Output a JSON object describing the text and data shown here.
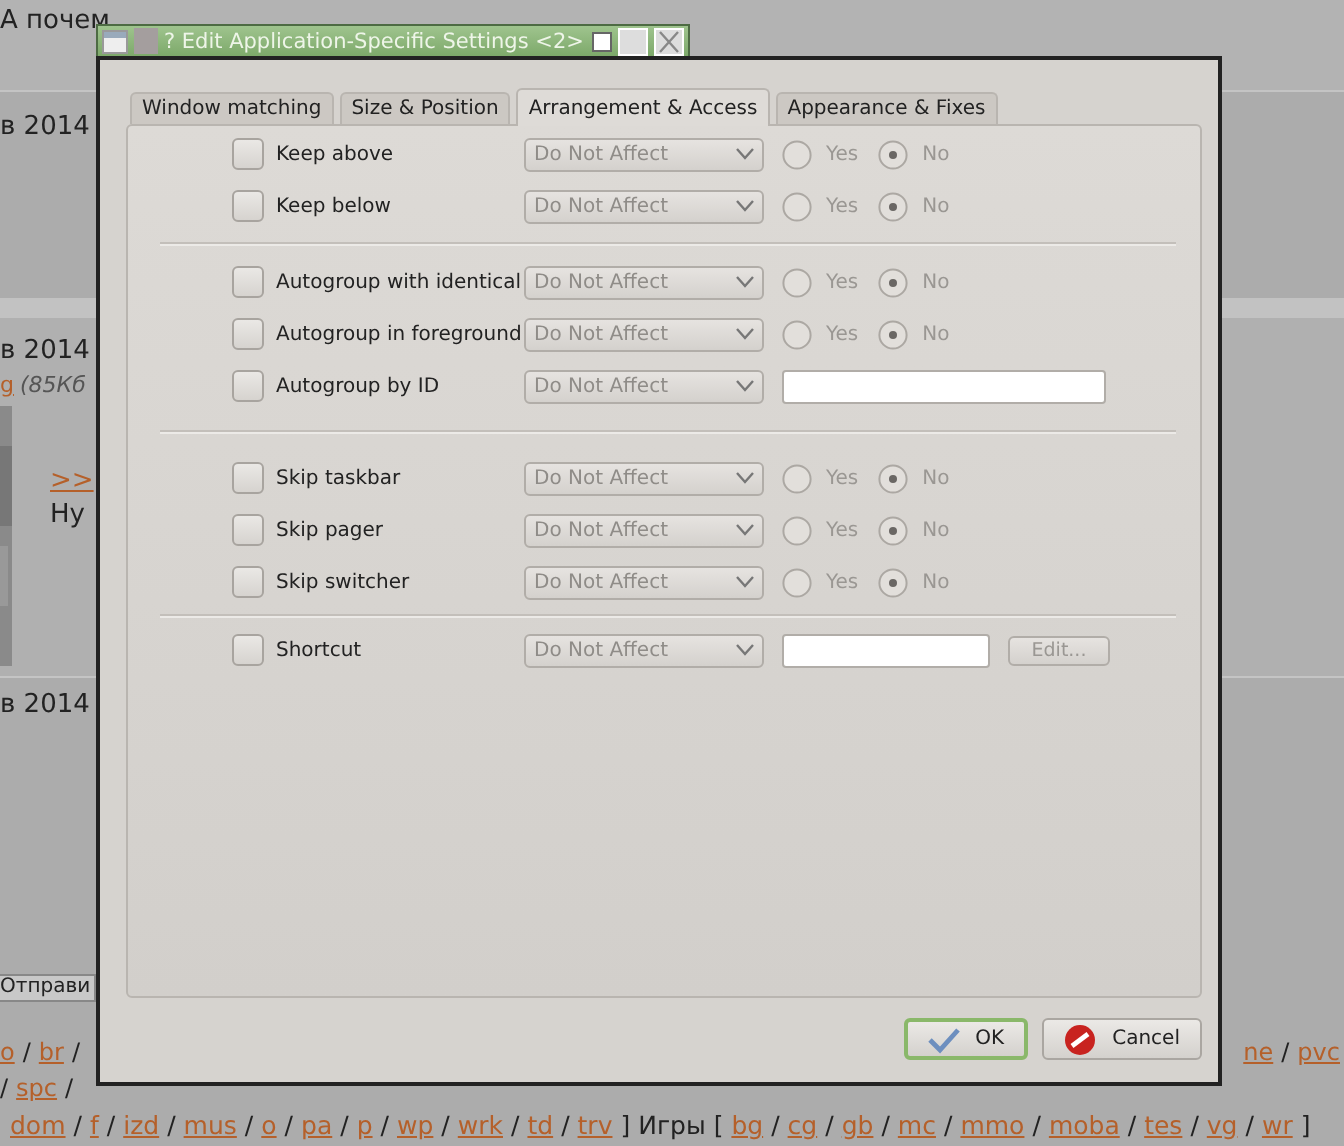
{
  "background_page": {
    "top_text": "А почем",
    "posts": [
      {
        "date": "в 2014"
      },
      {
        "date": "в 2014",
        "file_link": "g",
        "file_size": "(85Кб",
        "reply_link": ">>",
        "text": "Ну"
      },
      {
        "date": "в 2014"
      }
    ],
    "send_button": "Отправи",
    "link_lines": [
      {
        "left": [
          {
            "kind": "link",
            "text": "o"
          },
          {
            "kind": "text",
            "text": "/"
          },
          {
            "kind": "link",
            "text": "br"
          },
          {
            "kind": "text",
            "text": "/"
          }
        ],
        "right": [
          {
            "kind": "link",
            "text": "ne"
          },
          {
            "kind": "text",
            "text": "/"
          },
          {
            "kind": "link",
            "text": "pvc"
          }
        ]
      },
      {
        "left": [
          {
            "kind": "text",
            "text": "/"
          },
          {
            "kind": "link",
            "text": "spc"
          },
          {
            "kind": "text",
            "text": "/"
          }
        ]
      },
      {
        "left": [
          {
            "kind": "link",
            "text": "dom"
          },
          {
            "kind": "text",
            "text": "/"
          },
          {
            "kind": "link",
            "text": "f"
          },
          {
            "kind": "text",
            "text": "/"
          },
          {
            "kind": "link",
            "text": "izd"
          },
          {
            "kind": "text",
            "text": "/"
          },
          {
            "kind": "link",
            "text": "mus"
          },
          {
            "kind": "text",
            "text": "/"
          },
          {
            "kind": "link",
            "text": "o"
          },
          {
            "kind": "text",
            "text": "/"
          },
          {
            "kind": "link",
            "text": "pa"
          },
          {
            "kind": "text",
            "text": "/"
          },
          {
            "kind": "link",
            "text": "p"
          },
          {
            "kind": "text",
            "text": "/"
          },
          {
            "kind": "link",
            "text": "wp"
          },
          {
            "kind": "text",
            "text": "/"
          },
          {
            "kind": "link",
            "text": "wrk"
          },
          {
            "kind": "text",
            "text": "/"
          },
          {
            "kind": "link",
            "text": "td"
          },
          {
            "kind": "text",
            "text": "/"
          },
          {
            "kind": "link",
            "text": "trv"
          },
          {
            "kind": "text",
            "text": "]"
          },
          {
            "kind": "text",
            "text": "Игры ["
          },
          {
            "kind": "link",
            "text": "bg"
          },
          {
            "kind": "text",
            "text": "/"
          },
          {
            "kind": "link",
            "text": "cg"
          },
          {
            "kind": "text",
            "text": "/"
          },
          {
            "kind": "link",
            "text": "gb"
          },
          {
            "kind": "text",
            "text": "/"
          },
          {
            "kind": "link",
            "text": "mc"
          },
          {
            "kind": "text",
            "text": "/"
          },
          {
            "kind": "link",
            "text": "mmo"
          },
          {
            "kind": "text",
            "text": "/"
          },
          {
            "kind": "link",
            "text": "moba"
          },
          {
            "kind": "text",
            "text": "/"
          },
          {
            "kind": "link",
            "text": "tes"
          },
          {
            "kind": "text",
            "text": "/"
          },
          {
            "kind": "link",
            "text": "vg"
          },
          {
            "kind": "text",
            "text": "/"
          },
          {
            "kind": "link",
            "text": "wr"
          },
          {
            "kind": "text",
            "text": "]"
          }
        ]
      }
    ]
  },
  "window": {
    "title": "? Edit Application-Specific Settings <2>"
  },
  "tabs": [
    {
      "label": "Window matching",
      "selected": false
    },
    {
      "label": "Size & Position",
      "selected": false
    },
    {
      "label": "Arrangement & Access",
      "selected": true
    },
    {
      "label": "Appearance & Fixes",
      "selected": false
    }
  ],
  "groups": [
    {
      "rows": [
        {
          "kind": "yes_no",
          "label": "Keep above",
          "checked": false,
          "value": "Do Not Affect",
          "disabled": true,
          "options": [
            {
              "label": "Yes",
              "selected": false
            },
            {
              "label": "No",
              "selected": true
            }
          ]
        },
        {
          "kind": "yes_no",
          "label": "Keep below",
          "checked": false,
          "value": "Do Not Affect",
          "disabled": true,
          "options": [
            {
              "label": "Yes",
              "selected": false
            },
            {
              "label": "No",
              "selected": true
            }
          ]
        }
      ]
    },
    {
      "rows": [
        {
          "kind": "yes_no",
          "label": "Autogroup with identical",
          "checked": false,
          "value": "Do Not Affect",
          "disabled": true,
          "options": [
            {
              "label": "Yes",
              "selected": false
            },
            {
              "label": "No",
              "selected": true
            }
          ]
        },
        {
          "kind": "yes_no",
          "label": "Autogroup in foreground",
          "checked": false,
          "value": "Do Not Affect",
          "disabled": true,
          "options": [
            {
              "label": "Yes",
              "selected": false
            },
            {
              "label": "No",
              "selected": true
            }
          ]
        },
        {
          "kind": "text",
          "label": "Autogroup by ID",
          "checked": false,
          "value": "Do Not Affect",
          "disabled": true
        }
      ]
    },
    {
      "rows": [
        {
          "kind": "yes_no",
          "label": "Skip taskbar",
          "checked": false,
          "value": "Do Not Affect",
          "disabled": true,
          "options": [
            {
              "label": "Yes",
              "selected": false
            },
            {
              "label": "No",
              "selected": true
            }
          ]
        },
        {
          "kind": "yes_no",
          "label": "Skip pager",
          "checked": false,
          "value": "Do Not Affect",
          "disabled": true,
          "options": [
            {
              "label": "Yes",
              "selected": false
            },
            {
              "label": "No",
              "selected": true
            }
          ]
        },
        {
          "kind": "yes_no",
          "label": "Skip switcher",
          "checked": false,
          "value": "Do Not Affect",
          "disabled": true,
          "options": [
            {
              "label": "Yes",
              "selected": false
            },
            {
              "label": "No",
              "selected": true
            }
          ]
        }
      ]
    },
    {
      "rows": [
        {
          "kind": "shortcut",
          "label": "Shortcut",
          "checked": false,
          "value": "Do Not Affect",
          "disabled": true,
          "button": "Edit..."
        }
      ]
    }
  ],
  "buttons": [
    {
      "kind": "ok",
      "label": "OK",
      "focused": true
    },
    {
      "kind": "cancel",
      "label": "Cancel",
      "focused": false
    }
  ]
}
